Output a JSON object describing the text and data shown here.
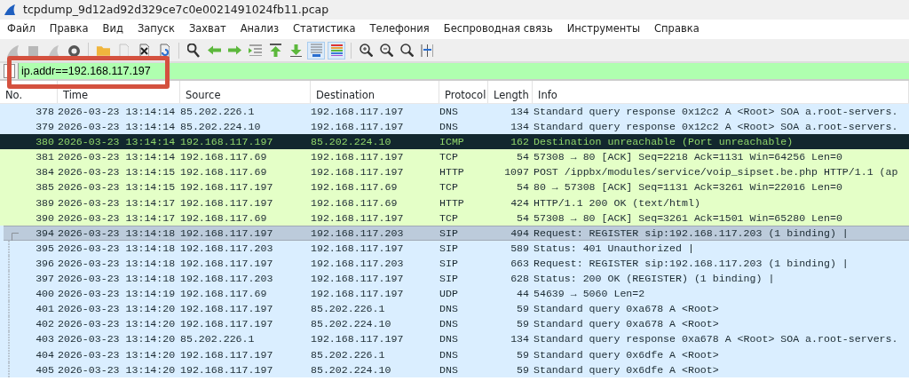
{
  "window": {
    "title": "tcpdump_9d12ad92d329ce7c0e0021491024fb11.pcap"
  },
  "menu": [
    "Файл",
    "Правка",
    "Вид",
    "Запуск",
    "Захват",
    "Анализ",
    "Статистика",
    "Телефония",
    "Беспроводная связь",
    "Инструменты",
    "Справка"
  ],
  "toolbar": [
    {
      "kind": "fin",
      "disabled": true
    },
    {
      "kind": "stop",
      "disabled": true
    },
    {
      "kind": "restart",
      "disabled": true
    },
    {
      "kind": "gear",
      "disabled": false
    },
    {
      "kind": "sep"
    },
    {
      "kind": "folder",
      "disabled": false
    },
    {
      "kind": "file",
      "disabled": true
    },
    {
      "kind": "close",
      "disabled": false
    },
    {
      "kind": "reload",
      "disabled": false
    },
    {
      "kind": "sep"
    },
    {
      "kind": "search",
      "disabled": false
    },
    {
      "kind": "back",
      "disabled": false
    },
    {
      "kind": "forward",
      "disabled": false
    },
    {
      "kind": "goto",
      "disabled": false
    },
    {
      "kind": "first",
      "disabled": false
    },
    {
      "kind": "last",
      "disabled": false
    },
    {
      "kind": "autoscroll",
      "disabled": false,
      "on": true
    },
    {
      "kind": "colorize",
      "disabled": false,
      "on": true
    },
    {
      "kind": "sep"
    },
    {
      "kind": "zoomin",
      "disabled": false
    },
    {
      "kind": "zoomout",
      "disabled": false
    },
    {
      "kind": "zoomreset",
      "disabled": false
    },
    {
      "kind": "resize",
      "disabled": false
    }
  ],
  "filter": {
    "value": "ip.addr==192.168.117.197"
  },
  "table": {
    "columns": [
      "No.",
      "Time",
      "Source",
      "Destination",
      "Protocol",
      "Length",
      "Info"
    ],
    "rows": [
      {
        "cells": [
          "378",
          "2026-03-23 13:14:14",
          "85.202.226.1",
          "192.168.117.197",
          "DNS",
          "134",
          "Standard query response 0x12c2 A <Root> SOA a.root-servers."
        ],
        "color": "#daeeff",
        "selected": false,
        "kind": "plain"
      },
      {
        "cells": [
          "379",
          "2026-03-23 13:14:14",
          "85.202.224.10",
          "192.168.117.197",
          "DNS",
          "134",
          "Standard query response 0x12c2 A <Root> SOA a.root-servers."
        ],
        "color": "#daeeff",
        "selected": false,
        "kind": "plain"
      },
      {
        "cells": [
          "380",
          "2026-03-23 13:14:14",
          "192.168.117.197",
          "85.202.224.10",
          "ICMP",
          "162",
          "Destination unreachable (Port unreachable)"
        ],
        "color": "#12272e",
        "selected": false,
        "kind": "plain"
      },
      {
        "cells": [
          "381",
          "2026-03-23 13:14:14",
          "192.168.117.69",
          "192.168.117.197",
          "TCP",
          "54",
          "57308 → 80 [ACK] Seq=2218 Ack=1131 Win=64256 Len=0"
        ],
        "color": "#e4ffc7",
        "selected": false,
        "kind": "plain"
      },
      {
        "cells": [
          "384",
          "2026-03-23 13:14:15",
          "192.168.117.69",
          "192.168.117.197",
          "HTTP",
          "1097",
          "POST /ippbx/modules/service/voip_sipset.be.php HTTP/1.1  (ap"
        ],
        "color": "#e4ffc7",
        "selected": false,
        "kind": "plain"
      },
      {
        "cells": [
          "385",
          "2026-03-23 13:14:15",
          "192.168.117.197",
          "192.168.117.69",
          "TCP",
          "54",
          "80 → 57308 [ACK] Seq=1131 Ack=3261 Win=22016 Len=0"
        ],
        "color": "#e4ffc7",
        "selected": false,
        "kind": "plain"
      },
      {
        "cells": [
          "389",
          "2026-03-23 13:14:17",
          "192.168.117.197",
          "192.168.117.69",
          "HTTP",
          "424",
          "HTTP/1.1 200 OK  (text/html)"
        ],
        "color": "#e4ffc7",
        "selected": false,
        "kind": "plain"
      },
      {
        "cells": [
          "390",
          "2026-03-23 13:14:17",
          "192.168.117.69",
          "192.168.117.197",
          "TCP",
          "54",
          "57308 → 80 [ACK] Seq=3261 Ack=1501 Win=65280 Len=0"
        ],
        "color": "#e4ffc7",
        "selected": false,
        "kind": "plain"
      },
      {
        "cells": [
          "394",
          "2026-03-23 13:14:18",
          "192.168.117.197",
          "192.168.117.203",
          "SIP",
          "494",
          "Request: REGISTER sip:192.168.117.203  (1 binding) |"
        ],
        "color": "#daeeff",
        "selected": true,
        "kind": "start"
      },
      {
        "cells": [
          "395",
          "2026-03-23 13:14:18",
          "192.168.117.203",
          "192.168.117.197",
          "SIP",
          "589",
          "Status: 401 Unauthorized |"
        ],
        "color": "#daeeff",
        "selected": false,
        "kind": "member"
      },
      {
        "cells": [
          "396",
          "2026-03-23 13:14:18",
          "192.168.117.197",
          "192.168.117.203",
          "SIP",
          "663",
          "Request: REGISTER sip:192.168.117.203  (1 binding) |"
        ],
        "color": "#daeeff",
        "selected": false,
        "kind": "member"
      },
      {
        "cells": [
          "397",
          "2026-03-23 13:14:18",
          "192.168.117.203",
          "192.168.117.197",
          "SIP",
          "628",
          "Status: 200 OK (REGISTER)  (1 binding) |"
        ],
        "color": "#daeeff",
        "selected": false,
        "kind": "member"
      },
      {
        "cells": [
          "400",
          "2026-03-23 13:14:19",
          "192.168.117.69",
          "192.168.117.197",
          "UDP",
          "44",
          "54639 → 5060 Len=2"
        ],
        "color": "#daeeff",
        "selected": false,
        "kind": "member"
      },
      {
        "cells": [
          "401",
          "2026-03-23 13:14:20",
          "192.168.117.197",
          "85.202.226.1",
          "DNS",
          "59",
          "Standard query 0xa678 A <Root>"
        ],
        "color": "#daeeff",
        "selected": false,
        "kind": "member"
      },
      {
        "cells": [
          "402",
          "2026-03-23 13:14:20",
          "192.168.117.197",
          "85.202.224.10",
          "DNS",
          "59",
          "Standard query 0xa678 A <Root>"
        ],
        "color": "#daeeff",
        "selected": false,
        "kind": "member"
      },
      {
        "cells": [
          "403",
          "2026-03-23 13:14:20",
          "85.202.226.1",
          "192.168.117.197",
          "DNS",
          "134",
          "Standard query response 0xa678 A <Root> SOA a.root-servers."
        ],
        "color": "#daeeff",
        "selected": false,
        "kind": "member"
      },
      {
        "cells": [
          "404",
          "2026-03-23 13:14:20",
          "192.168.117.197",
          "85.202.226.1",
          "DNS",
          "59",
          "Standard query 0x6dfe A <Root>"
        ],
        "color": "#daeeff",
        "selected": false,
        "kind": "member"
      },
      {
        "cells": [
          "405",
          "2026-03-23 13:14:20",
          "192.168.117.197",
          "85.202.224.10",
          "DNS",
          "59",
          "Standard query 0x6dfe A <Root>"
        ],
        "color": "#daeeff",
        "selected": false,
        "kind": "member"
      }
    ]
  }
}
